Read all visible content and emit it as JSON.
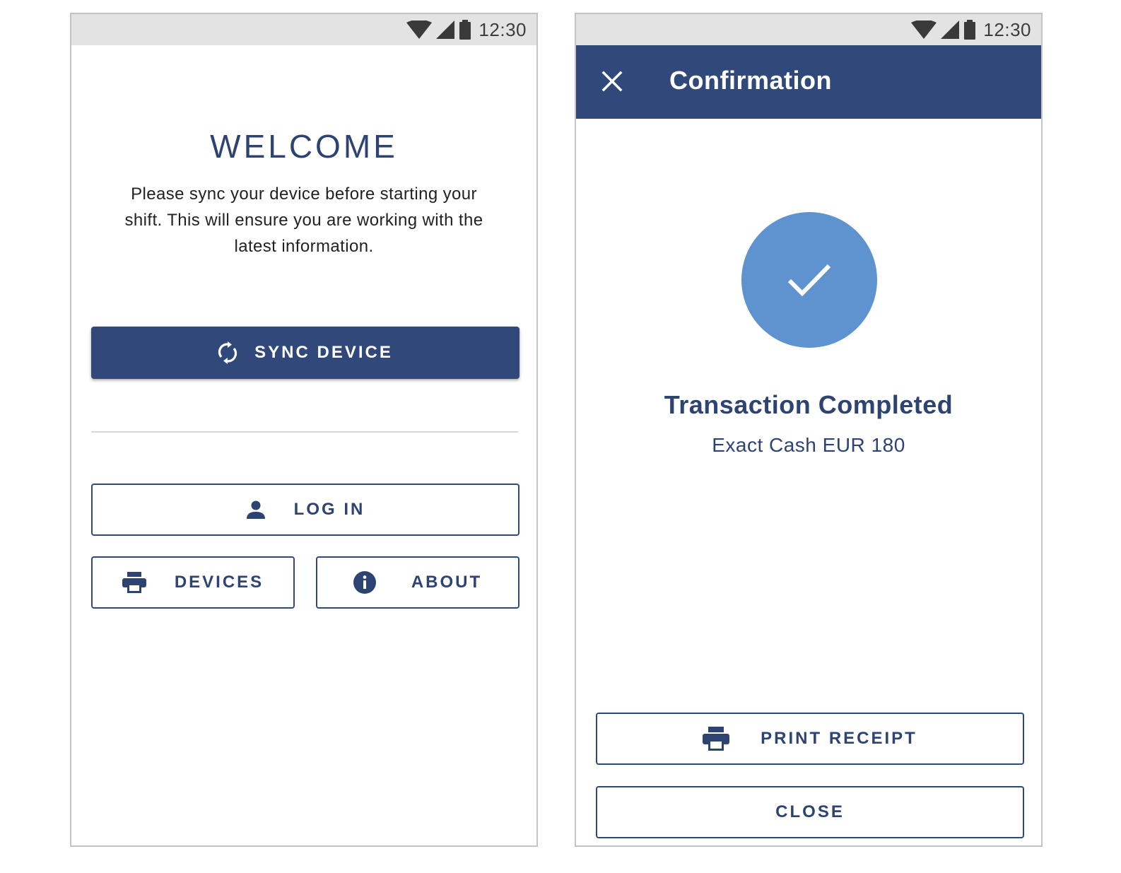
{
  "status_bar": {
    "time": "12:30"
  },
  "welcome_screen": {
    "title": "WELCOME",
    "message": "Please sync your device before starting your shift. This will ensure you are working with the latest information.",
    "sync_button": {
      "label": "SYNC DEVICE",
      "icon": "sync-icon"
    },
    "login_button": {
      "label": "LOG IN",
      "icon": "person-icon"
    },
    "devices_button": {
      "label": "DEVICES",
      "icon": "printer-icon"
    },
    "about_button": {
      "label": "ABOUT",
      "icon": "info-icon"
    }
  },
  "confirmation_screen": {
    "title": "Confirmation",
    "close_icon": "close-icon",
    "status_icon": "check-icon",
    "heading": "Transaction Completed",
    "detail": "Exact Cash EUR 180",
    "print_button": {
      "label": "PRINT RECEIPT",
      "icon": "printer-icon"
    },
    "close_button": {
      "label": "CLOSE"
    }
  },
  "colors": {
    "primary": "#30487a",
    "success": "#5e93cf",
    "status_bar": "#e3e3e3",
    "divider": "#d6d6d6"
  }
}
